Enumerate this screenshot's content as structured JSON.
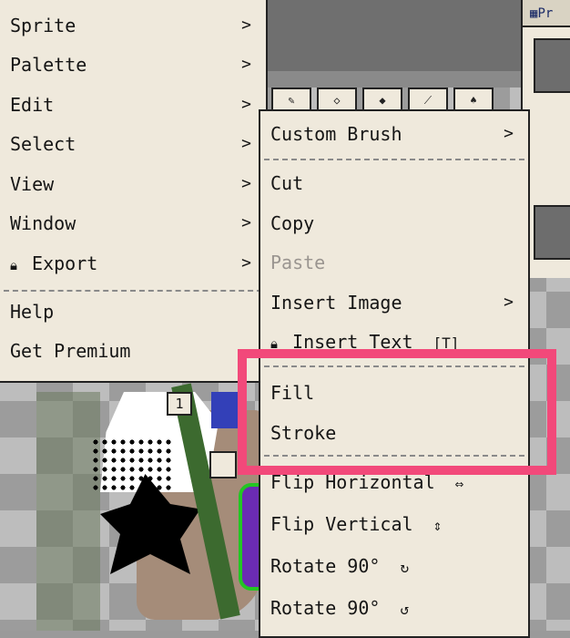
{
  "main_menu": {
    "items": [
      {
        "label": "Sprite",
        "arrow": ">"
      },
      {
        "label": "Palette",
        "arrow": ">"
      },
      {
        "label": "Edit",
        "arrow": ">"
      },
      {
        "label": "Select",
        "arrow": ">"
      },
      {
        "label": "View",
        "arrow": ">"
      },
      {
        "label": "Window",
        "arrow": ">"
      },
      {
        "label": "Export",
        "arrow": ">",
        "locked": true
      }
    ],
    "help_label": "Help",
    "premium_label": "Get Premium"
  },
  "edit_submenu": {
    "custom_brush": "Custom Brush",
    "cut": "Cut",
    "copy": "Copy",
    "paste": "Paste",
    "insert_image": "Insert Image",
    "insert_text": "Insert Text",
    "fill": "Fill",
    "stroke": "Stroke",
    "flip_horizontal": "Flip Horizontal",
    "flip_vertical": "Flip Vertical",
    "rotate_cw": "Rotate 90°",
    "rotate_ccw": "Rotate 90°",
    "arrow": ">"
  },
  "panel": {
    "title": "Pr"
  },
  "canvas": {
    "layer_badge": "1"
  },
  "colors": {
    "menu_bg": "#efe9dc",
    "highlight": "#f2497a",
    "disabled_text": "#9a9590"
  },
  "icons": {
    "lock": "lock-icon",
    "text_tool": "text-tool-icon",
    "flip_h": "flip-horizontal-icon",
    "flip_v": "flip-vertical-icon",
    "rotate_cw": "rotate-cw-icon",
    "rotate_ccw": "rotate-ccw-icon"
  }
}
